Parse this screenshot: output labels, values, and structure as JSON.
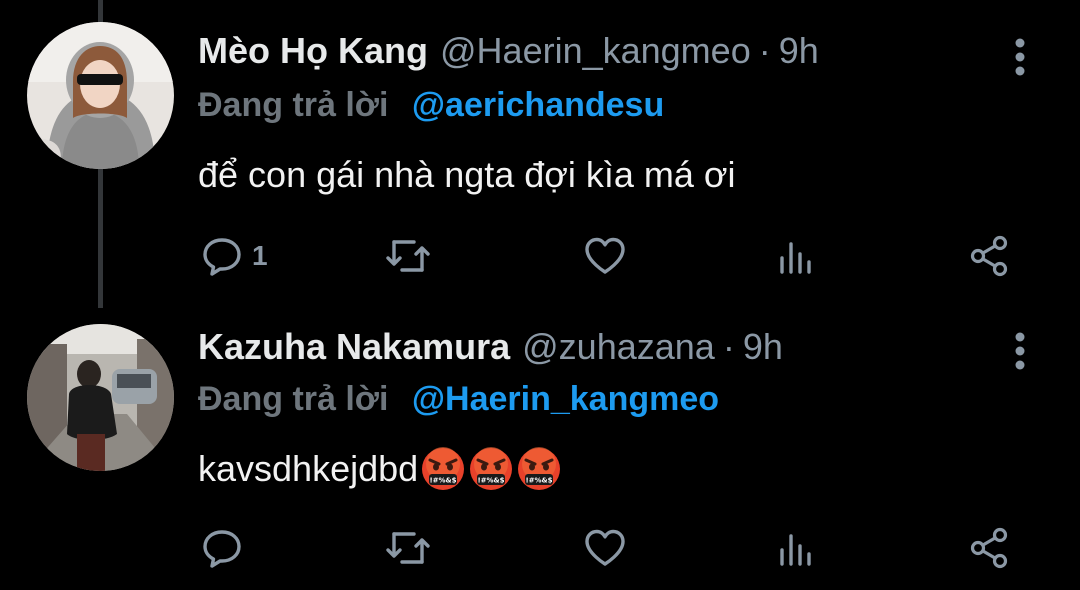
{
  "tweets": [
    {
      "name": "Mèo Họ Kang",
      "handle": "@Haerin_kangmeo",
      "separator": "·",
      "time": "9h",
      "replying_label": "Đang trả lời",
      "replying_to": "@aerichandesu",
      "text": "để con gái nhà ngta đợi kìa má ơi",
      "reply_count": "1"
    },
    {
      "name": "Kazuha Nakamura",
      "handle": "@zuhazana",
      "separator": "·",
      "time": "9h",
      "replying_label": "Đang trả lời",
      "replying_to": "@Haerin_kangmeo",
      "text": "kavsdhkejdbd",
      "emojis": [
        "face-with-symbols-on-mouth",
        "face-with-symbols-on-mouth",
        "face-with-symbols-on-mouth"
      ],
      "reply_count": ""
    }
  ],
  "colors": {
    "background": "#000000",
    "name": "#e7e9ea",
    "secondary": "#8b98a5",
    "link": "#1d9bf0",
    "icon": "#8b98a5"
  }
}
